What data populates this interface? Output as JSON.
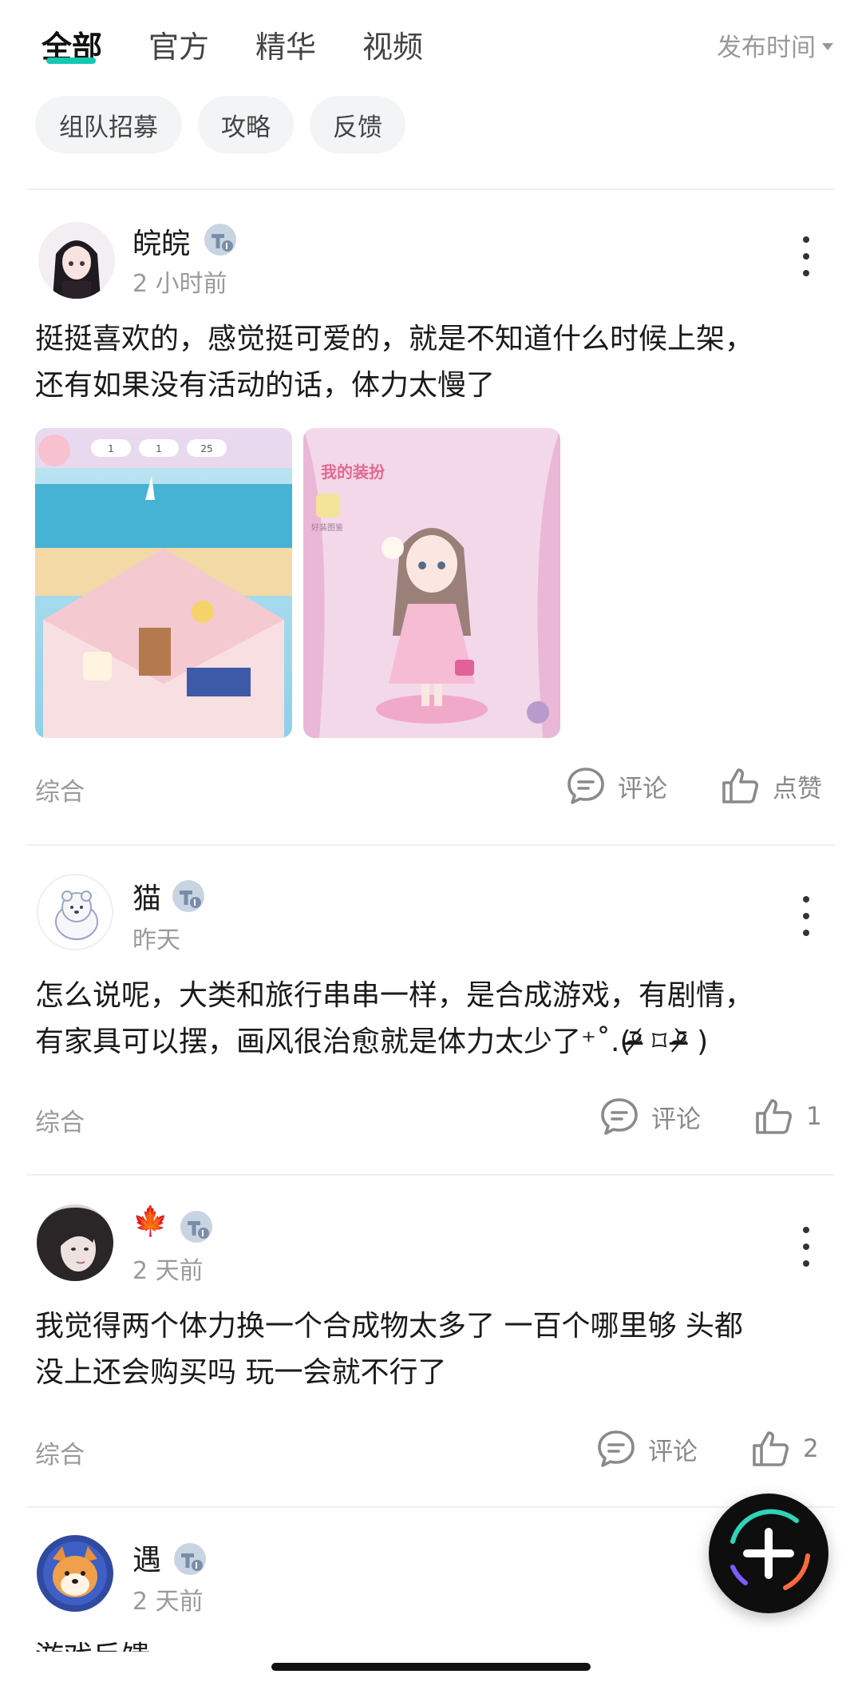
{
  "tabs": [
    {
      "label": "全部",
      "active": true
    },
    {
      "label": "官方",
      "active": false
    },
    {
      "label": "精华",
      "active": false
    },
    {
      "label": "视频",
      "active": false
    }
  ],
  "sort": {
    "label": "发布时间"
  },
  "chips": [
    "组队招募",
    "攻略",
    "反馈"
  ],
  "posts": [
    {
      "username": "皖皖",
      "time": "2 小时前",
      "content": [
        "挺挺喜欢的，感觉挺可爱的，就是不知道什么时候上架，",
        "还有如果没有活动的话，体力太慢了"
      ],
      "tag": "综合",
      "comment_label": "评论",
      "like_label": "点赞",
      "images": [
        {
          "texts": [
            "1",
            "1",
            "25"
          ]
        },
        {
          "texts": [
            "我的装扮",
            "好装图鉴"
          ]
        }
      ]
    },
    {
      "username": "猫",
      "time": "昨天",
      "content": [
        "怎么说呢，大类和旅行串串一样，是合成游戏，有剧情，",
        "有家具可以摆，画风很治愈就是体力太少了⁺˚.(ᵒ̴̶̷᷄ ⌑ ᵒ̴̶̷᷅ )"
      ],
      "tag": "综合",
      "comment_label": "评论",
      "like_label": "1"
    },
    {
      "username": "🍁",
      "time": "2 天前",
      "content": [
        "我觉得两个体力换一个合成物太多了 一百个哪里够 头都",
        "没上还会购买吗 玩一会就不行了"
      ],
      "tag": "综合",
      "comment_label": "评论",
      "like_label": "2"
    },
    {
      "username": "遇",
      "time": "2 天前",
      "content": [
        "游戏反馈"
      ]
    }
  ],
  "colors": {
    "accent": "#14c8b4",
    "badge": "#9fb3cc"
  },
  "icons": {
    "more": "more-vertical-icon",
    "comment": "comment-icon",
    "like": "thumbs-up-icon",
    "fab": "plus-icon",
    "level": "level-badge-icon"
  }
}
